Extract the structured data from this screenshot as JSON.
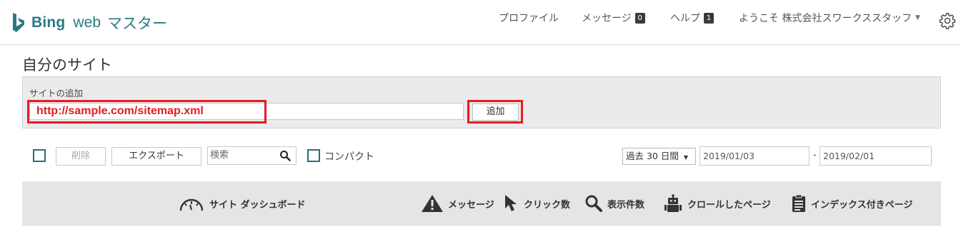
{
  "brand": {
    "bing": "Bing",
    "web": "web",
    "master": "マスター",
    "color": "#2a7a86"
  },
  "nav": {
    "profile": "プロファイル",
    "messages": "メッセージ",
    "messages_count": "0",
    "help": "ヘルプ",
    "help_count": "1",
    "welcome": "ようこそ 株式会社スワークススタッフ",
    "settings_icon": "gear-icon"
  },
  "page": {
    "title": "自分のサイト"
  },
  "add_site": {
    "label": "サイトの追加",
    "url_value": "http://sample.com/sitemap.xml",
    "button": "追加",
    "highlight_color": "#e61b23"
  },
  "toolbar": {
    "delete": "削除",
    "export": "エクスポート",
    "search_placeholder": "検索",
    "compact": "コンパクト",
    "range": "過去 30 日間",
    "date_from": "2019/01/03",
    "date_sep": "-",
    "date_to": "2019/02/01"
  },
  "metrics": {
    "dashboard": "サイト ダッシュボード",
    "messages": "メッセージ",
    "clicks": "クリック数",
    "impressions": "表示件数",
    "crawled": "クロールしたページ",
    "indexed": "インデックス付きページ"
  }
}
